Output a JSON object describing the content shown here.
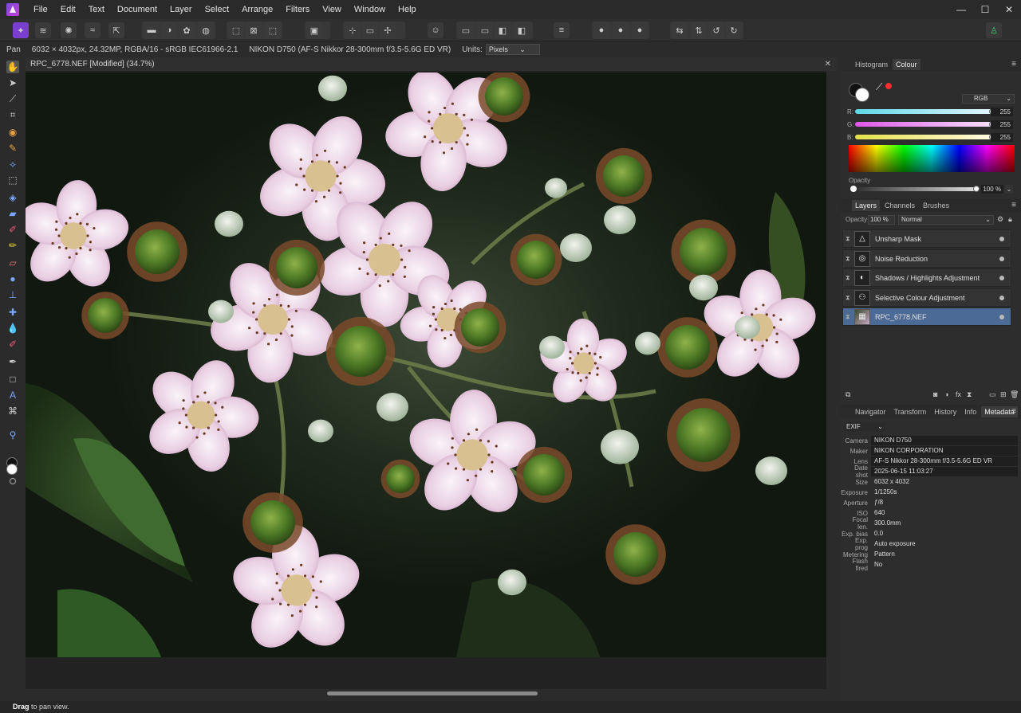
{
  "menubar": {
    "items": [
      "File",
      "Edit",
      "Text",
      "Document",
      "Layer",
      "Select",
      "Arrange",
      "Filters",
      "View",
      "Window",
      "Help"
    ]
  },
  "context": {
    "tool": "Pan",
    "image_info": "6032 × 4032px, 24.32MP, RGBA/16 - sRGB IEC61966-2.1",
    "camera_info": "NIKON D750 (AF-S Nikkor 28-300mm f/3.5-5.6G ED VR)",
    "units_label": "Units:",
    "units_value": "Pixels"
  },
  "document": {
    "title": "RPC_6778.NEF [Modified] (34.7%)"
  },
  "status": {
    "bold": "Drag",
    "text": " to pan view."
  },
  "colour_panel": {
    "tabs": [
      "Histogram",
      "Colour"
    ],
    "active_tab": "Colour",
    "model": "RGB",
    "r_label": "R:",
    "r_value": "255",
    "g_label": "G:",
    "g_value": "255",
    "b_label": "B:",
    "b_value": "255",
    "opacity_label": "Opacity",
    "opacity_value": "100 %"
  },
  "layers_panel": {
    "tabs": [
      "Layers",
      "Channels",
      "Brushes"
    ],
    "active_tab": "Layers",
    "opacity_label": "Opacity:",
    "opacity_value": "100 %",
    "blend_mode": "Normal",
    "layers": [
      {
        "name": "Unsharp Mask",
        "icon": "triangle-icon"
      },
      {
        "name": "Noise Reduction",
        "icon": "noise-icon"
      },
      {
        "name": "Shadows / Highlights Adjustment",
        "icon": "sun-icon"
      },
      {
        "name": "Selective Colour Adjustment",
        "icon": "selective-colour-icon"
      },
      {
        "name": "RPC_6778.NEF",
        "icon": "image-thumb",
        "selected": true
      }
    ]
  },
  "metadata_panel": {
    "tabs": [
      "Navigator",
      "Transform",
      "History",
      "Info",
      "Metadata"
    ],
    "active_tab": "Metadata",
    "section": "EXIF",
    "rows": [
      {
        "key": "Camera",
        "value": "NIKON D750",
        "boxed": true
      },
      {
        "key": "Maker",
        "value": "NIKON CORPORATION",
        "boxed": true
      },
      {
        "key": "Lens",
        "value": "AF-S Nikkor 28-300mm f/3.5-5.6G ED VR",
        "boxed": true
      },
      {
        "key": "Date shot",
        "value": "2025-06-15 11:03:27",
        "boxed": true
      },
      {
        "key": "Size",
        "value": "6032 x 4032",
        "boxed": false
      },
      {
        "key": "Exposure",
        "value": "1/1250s",
        "boxed": false
      },
      {
        "key": "Aperture",
        "value": "ƒ/8",
        "boxed": false
      },
      {
        "key": "ISO",
        "value": "640",
        "boxed": false
      },
      {
        "key": "Focal len.",
        "value": "300.0mm",
        "boxed": false
      },
      {
        "key": "Exp. bias",
        "value": "0.0",
        "boxed": false
      },
      {
        "key": "Exp. prog",
        "value": "Auto exposure",
        "boxed": false
      },
      {
        "key": "Metering",
        "value": "Pattern",
        "boxed": false
      },
      {
        "key": "Flash fired",
        "value": "No",
        "boxed": false
      }
    ]
  },
  "colors": {
    "accent": "#4c6a96",
    "r_track": "#5fd9e6",
    "g_track": "#e055e8",
    "b_track": "#e6e04a",
    "active_color_swatch": "#ff2d2d"
  }
}
